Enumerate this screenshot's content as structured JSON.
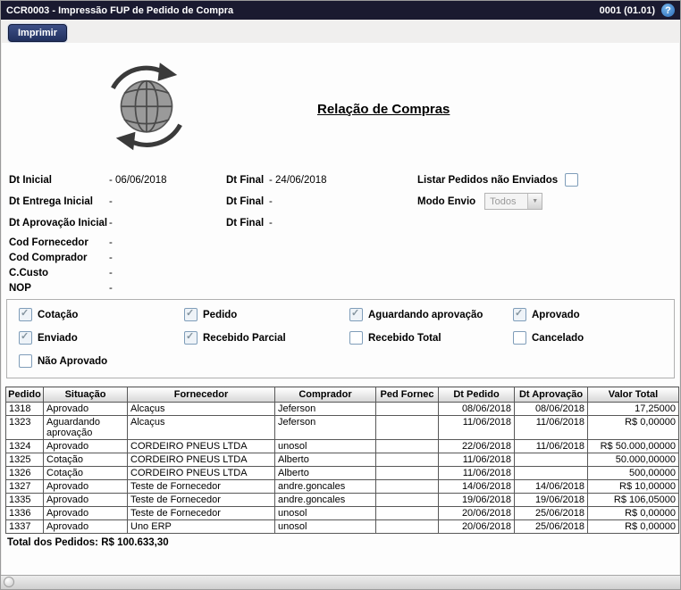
{
  "titlebar": {
    "title": "CCR0003 - Impressão FUP de Pedido de Compra",
    "version": "0001 (01.01)",
    "help_glyph": "?"
  },
  "toolbar": {
    "print_label": "Imprimir"
  },
  "report": {
    "title": "Relação de Compras"
  },
  "filters": {
    "rows": [
      {
        "label": "Dt Inicial",
        "value": "- 06/06/2018",
        "label2": "Dt Final",
        "value2": "- 24/06/2018"
      },
      {
        "label": "Dt Entrega Inicial",
        "value": "-",
        "label2": "Dt Final",
        "value2": "-"
      },
      {
        "label": "Dt Aprovação Inicial",
        "value": "-",
        "label2": "Dt Final",
        "value2": "-"
      },
      {
        "label": "Cod Fornecedor",
        "value": "-"
      },
      {
        "label": "Cod Comprador",
        "value": "-"
      },
      {
        "label": "C.Custo",
        "value": "-"
      },
      {
        "label": "NOP",
        "value": "-"
      }
    ],
    "listar_label": "Listar Pedidos não Enviados",
    "listar_checked": false,
    "modo_envio_label": "Modo Envio",
    "modo_envio_value": "Todos"
  },
  "status_filters": [
    {
      "label": "Cotação",
      "checked": true
    },
    {
      "label": "Pedido",
      "checked": true
    },
    {
      "label": "Aguardando aprovação",
      "checked": true
    },
    {
      "label": "Aprovado",
      "checked": true
    },
    {
      "label": "Enviado",
      "checked": true
    },
    {
      "label": "Recebido Parcial",
      "checked": true
    },
    {
      "label": "Recebido Total",
      "checked": false
    },
    {
      "label": "Cancelado",
      "checked": false
    },
    {
      "label": "Não Aprovado",
      "checked": false
    }
  ],
  "table": {
    "headers": [
      "Pedido",
      "Situação",
      "Fornecedor",
      "Comprador",
      "Ped Fornec",
      "Dt Pedido",
      "Dt Aprovação",
      "Valor Total"
    ],
    "rows": [
      [
        "1318",
        "Aprovado",
        "Alcaçus",
        "Jeferson",
        "",
        "08/06/2018",
        "08/06/2018",
        "17,25000"
      ],
      [
        "1323",
        "Aguardando aprovação",
        "Alcaçus",
        "Jeferson",
        "",
        "11/06/2018",
        "11/06/2018",
        "R$ 0,00000"
      ],
      [
        "1324",
        "Aprovado",
        "CORDEIRO PNEUS LTDA",
        "unosol",
        "",
        "22/06/2018",
        "11/06/2018",
        "R$ 50.000,00000"
      ],
      [
        "1325",
        "Cotação",
        "CORDEIRO PNEUS LTDA",
        "Alberto",
        "",
        "11/06/2018",
        "",
        "50.000,00000"
      ],
      [
        "1326",
        "Cotação",
        "CORDEIRO PNEUS LTDA",
        "Alberto",
        "",
        "11/06/2018",
        "",
        "500,00000"
      ],
      [
        "1327",
        "Aprovado",
        "Teste de Fornecedor",
        "andre.goncales",
        "",
        "14/06/2018",
        "14/06/2018",
        "R$ 10,00000"
      ],
      [
        "1335",
        "Aprovado",
        "Teste de Fornecedor",
        "andre.goncales",
        "",
        "19/06/2018",
        "19/06/2018",
        "R$ 106,05000"
      ],
      [
        "1336",
        "Aprovado",
        "Teste de Fornecedor",
        "unosol",
        "",
        "20/06/2018",
        "25/06/2018",
        "R$ 0,00000"
      ],
      [
        "1337",
        "Aprovado",
        "Uno ERP",
        "unosol",
        "",
        "20/06/2018",
        "25/06/2018",
        "R$ 0,00000"
      ]
    ],
    "total": "Total dos Pedidos: R$ 100.633,30"
  }
}
